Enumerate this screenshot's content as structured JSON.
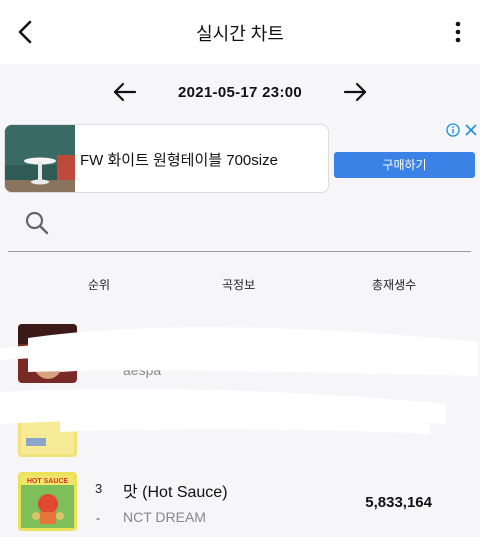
{
  "header": {
    "title": "실시간 차트",
    "back_icon": "chevron-left-icon",
    "menu_icon": "kebab-menu-icon"
  },
  "date_nav": {
    "datetime": "2021-05-17 23:00",
    "prev_icon": "arrow-left-icon",
    "next_icon": "arrow-right-icon"
  },
  "ad": {
    "text": "FW 화이트 원형테이블 700size",
    "button_label": "구매하기",
    "accent": "#3b82e6"
  },
  "search": {
    "icon": "search-icon"
  },
  "columns": {
    "rank": "순위",
    "info": "곡정보",
    "plays": "총재생수"
  },
  "rows": [
    {
      "artist": "aespa"
    },
    {},
    {
      "rank": "3",
      "change": "-",
      "title": "맛 (Hot Sauce)",
      "artist": "NCT DREAM",
      "plays": "5,833,164"
    }
  ]
}
